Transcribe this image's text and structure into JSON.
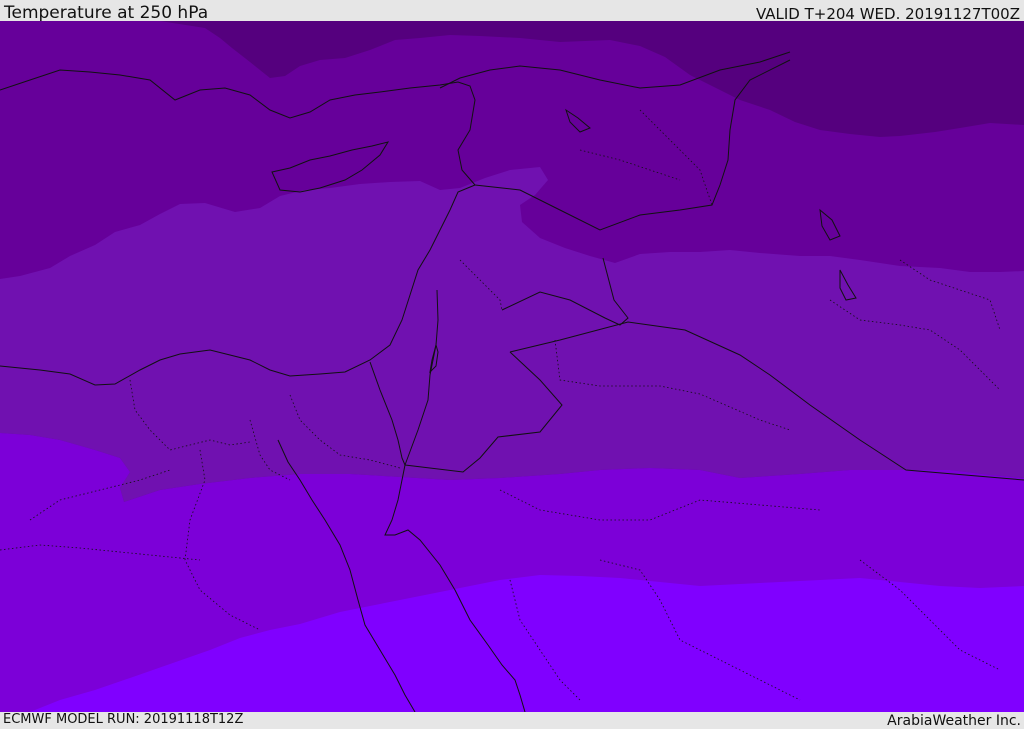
{
  "header": {
    "title": "Temperature at 250 hPa",
    "valid_time": "VALID T+204 WED. 20191127T00Z"
  },
  "footer": {
    "model_run": "ECMWF MODEL RUN: 20191118T12Z",
    "credit": "ArabiaWeather Inc."
  },
  "map": {
    "region": "Eastern Mediterranean / Middle East",
    "temperature_band_colors": [
      "#55007e",
      "#66009a",
      "#7011b0",
      "#7c00d8",
      "#8000ff"
    ],
    "border_color": "#111111"
  }
}
